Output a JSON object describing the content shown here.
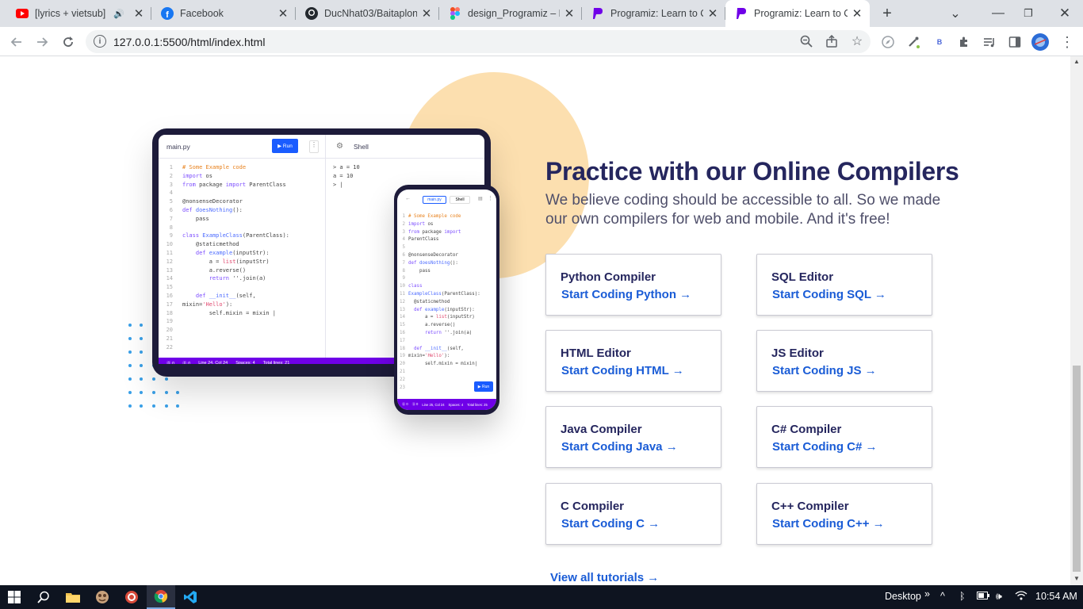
{
  "browser": {
    "tabs": [
      {
        "title": "[lyrics + vietsub] L",
        "icon": "youtube-icon",
        "color": "#ff0000"
      },
      {
        "title": "Facebook",
        "icon": "facebook-icon",
        "color": "#1877f2"
      },
      {
        "title": "DucNhat03/Baitaplon",
        "icon": "github-icon",
        "color": "#24292f"
      },
      {
        "title": "design_Programiz – Fi",
        "icon": "figma-icon",
        "color": "#f24e1e"
      },
      {
        "title": "Programiz: Learn to C",
        "icon": "programiz-icon",
        "color": "#6f00e8"
      },
      {
        "title": "Programiz: Learn to C",
        "icon": "programiz-icon",
        "color": "#6f00e8"
      }
    ],
    "new_tab": "+",
    "url": "127.0.0.1:5500/html/index.html",
    "profile_letter": "B"
  },
  "illustration": {
    "tablet": {
      "file": "main.py",
      "run": "▶ Run",
      "shell": "Shell",
      "code": [
        {
          "n": "1",
          "html": "<span class='cm'># Some Example code</span>"
        },
        {
          "n": "2",
          "html": "<span class='kw'>import</span> os"
        },
        {
          "n": "3",
          "html": "<span class='kw'>from</span> package <span class='kw'>import</span> ParentClass"
        },
        {
          "n": "4",
          "html": ""
        },
        {
          "n": "5",
          "html": "@nonsenseDecorator"
        },
        {
          "n": "6",
          "html": "<span class='kw'>def</span> <span class='fn'>doesNothing</span>():"
        },
        {
          "n": "7",
          "html": "    pass"
        },
        {
          "n": "8",
          "html": ""
        },
        {
          "n": "9",
          "html": "<span class='kw'>class</span> <span class='fn'>ExampleClass</span>(ParentClass):"
        },
        {
          "n": "10",
          "html": "    @staticmethod"
        },
        {
          "n": "11",
          "html": "    <span class='kw'>def</span> <span class='fn'>example</span>(inputStr):"
        },
        {
          "n": "12",
          "html": "        a = <span class='st'>list</span>(inputStr)"
        },
        {
          "n": "13",
          "html": "        a.reverse()"
        },
        {
          "n": "14",
          "html": "        <span class='kw'>return</span> ''.join(a)"
        },
        {
          "n": "15",
          "html": ""
        },
        {
          "n": "16",
          "html": "    <span class='kw'>def</span> <span class='fn'>__init__</span>(self,"
        },
        {
          "n": "17",
          "html": "mixin=<span class='st'>'Hello'</span>):"
        },
        {
          "n": "18",
          "html": "        self.mixin = mixin |"
        },
        {
          "n": "19",
          "html": ""
        },
        {
          "n": "20",
          "html": ""
        },
        {
          "n": "21",
          "html": ""
        },
        {
          "n": "22",
          "html": ""
        }
      ],
      "shell_output": [
        "> a = 10",
        "a = 10",
        "> |"
      ],
      "status": [
        "⓪ 0",
        "⓪ 0",
        "Line 24, Col 24",
        "Spaces: 4",
        "Total lines: 21"
      ]
    },
    "phone": {
      "tab_a": "main.py",
      "tab_b": "Shell",
      "run": "▶ Run",
      "code": [
        {
          "n": "1",
          "html": "<span class='cm'># Some Example code</span>"
        },
        {
          "n": "2",
          "html": "<span class='kw'>import</span> os"
        },
        {
          "n": "3",
          "html": "<span class='kw'>from</span> package <span class='kw'>import</span>"
        },
        {
          "n": "4",
          "html": "ParentClass"
        },
        {
          "n": "5",
          "html": ""
        },
        {
          "n": "6",
          "html": "@nonsenseDecorator"
        },
        {
          "n": "7",
          "html": "<span class='kw'>def</span> <span class='fn'>doesNothing</span>():"
        },
        {
          "n": "8",
          "html": "    pass"
        },
        {
          "n": "9",
          "html": ""
        },
        {
          "n": "10",
          "html": "<span class='kw'>class</span>"
        },
        {
          "n": "11",
          "html": "<span class='fn'>ExampleClass</span>(ParentClass):"
        },
        {
          "n": "12",
          "html": "  @staticmethod"
        },
        {
          "n": "13",
          "html": "  <span class='kw'>def</span> <span class='fn'>example</span>(inputStr):"
        },
        {
          "n": "14",
          "html": "      a = <span class='st'>list</span>(inputStr)"
        },
        {
          "n": "15",
          "html": "      a.reverse()"
        },
        {
          "n": "16",
          "html": "      <span class='kw'>return</span> ''.join(a)"
        },
        {
          "n": "17",
          "html": ""
        },
        {
          "n": "18",
          "html": "  <span class='kw'>def</span> <span class='fn'>__init__</span>(self,"
        },
        {
          "n": "19",
          "html": "mixin=<span class='st'>'Hello'</span>):"
        },
        {
          "n": "20",
          "html": "      self.mixin = mixin|"
        },
        {
          "n": "21",
          "html": ""
        },
        {
          "n": "22",
          "html": ""
        },
        {
          "n": "23",
          "html": ""
        }
      ],
      "status": [
        "⓪ 0",
        "⓪ 0",
        "Line 25, Col 24",
        "Spaces: 4",
        "Total lines: 25"
      ]
    }
  },
  "section": {
    "title": "Practice with our Online Compilers",
    "subtitle": "We believe coding should be accessible to all. So we made our own compilers for web and mobile. And it's free!",
    "cards": [
      {
        "title": "Python Compiler",
        "link": "Start Coding Python →"
      },
      {
        "title": "SQL Editor",
        "link": "Start Coding SQL →"
      },
      {
        "title": "HTML Editor",
        "link": "Start Coding HTML →"
      },
      {
        "title": "JS Editor",
        "link": "Start Coding JS →"
      },
      {
        "title": "Java Compiler",
        "link": "Start Coding Java →"
      },
      {
        "title": "C# Compiler",
        "link": "Start Coding C# →"
      },
      {
        "title": "C Compiler",
        "link": "Start Coding C →"
      },
      {
        "title": "C++ Compiler",
        "link": "Start Coding C++ →"
      }
    ],
    "view_all": "View all tutorials →"
  },
  "taskbar": {
    "desktop": "Desktop",
    "chevron": "»",
    "time": "10:54 AM"
  },
  "colors": {
    "accent": "#1a5cd6",
    "heading": "#25265e",
    "brand_purple": "#6f00e8",
    "blob": "#fcdfaf"
  }
}
